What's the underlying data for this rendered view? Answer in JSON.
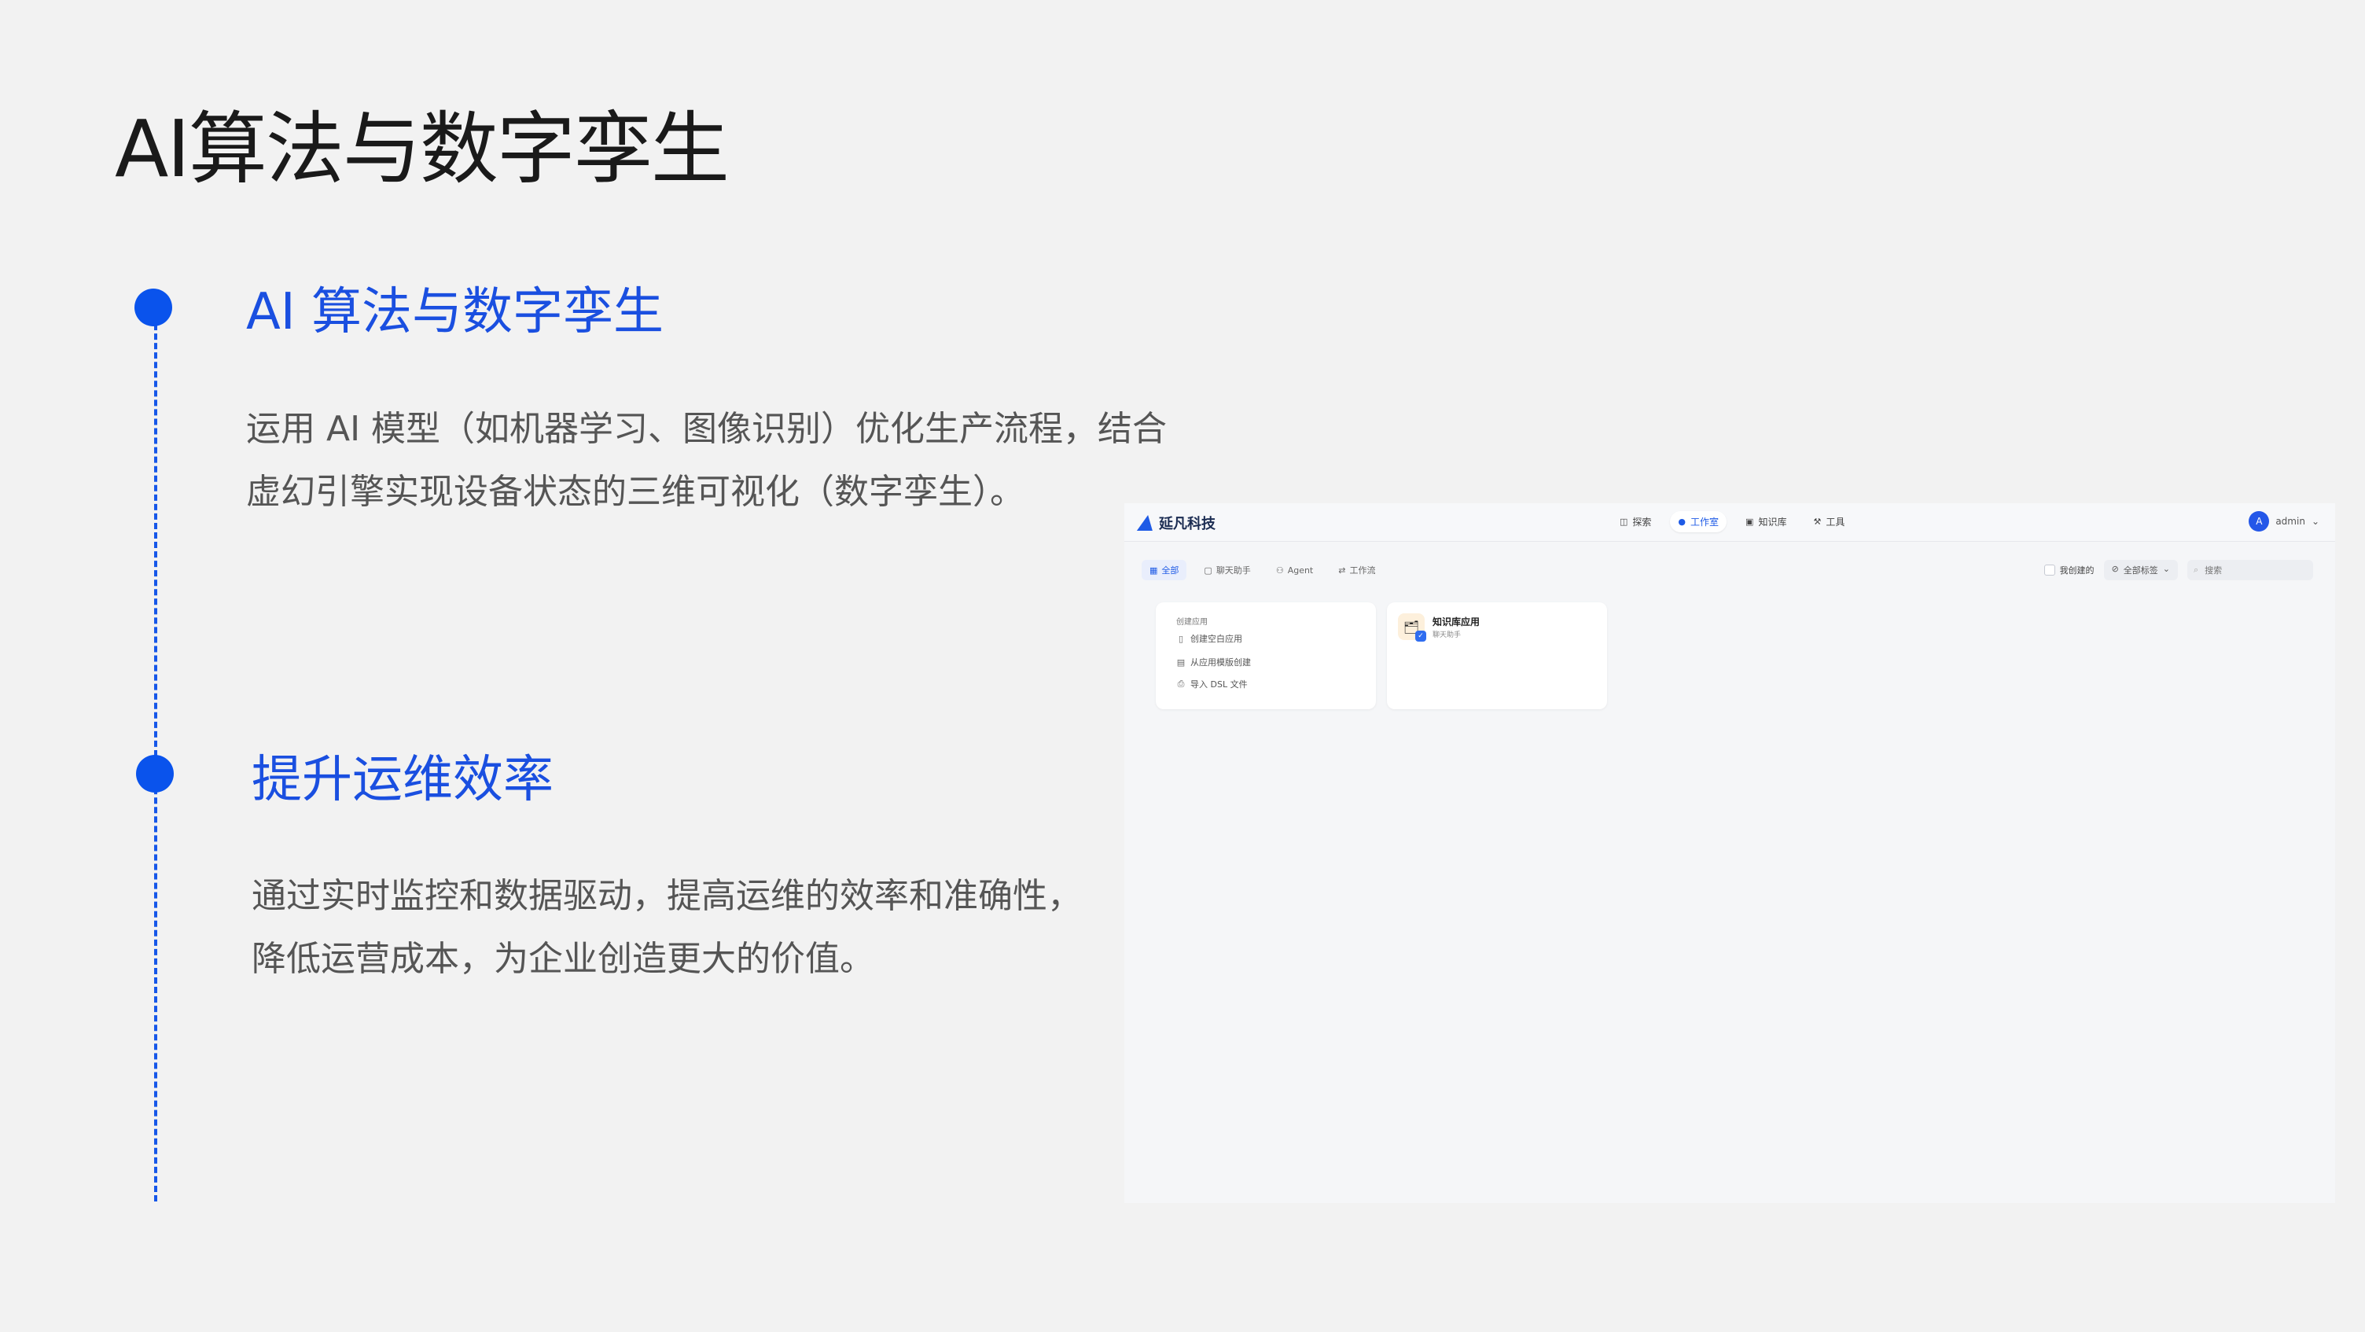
{
  "slide": {
    "title": "AI算法与数字孪生",
    "sections": [
      {
        "title": "AI 算法与数字孪生",
        "lines": [
          "运用 AI 模型（如机器学习、图像识别）优化生产流程，结合",
          "虚幻引擎实现设备状态的三维可视化（数字孪生）。"
        ]
      },
      {
        "title": "提升运维效率",
        "lines": [
          "通过实时监控和数据驱动，提高运维的效率和准确性，",
          "降低运营成本，为企业创造更大的价值。"
        ]
      }
    ]
  },
  "app": {
    "brand": "延凡科技",
    "nav": [
      {
        "label": "探索",
        "icon": "explore-icon"
      },
      {
        "label": "工作室",
        "icon": "studio-icon",
        "active": true
      },
      {
        "label": "知识库",
        "icon": "knowledge-icon"
      },
      {
        "label": "工具",
        "icon": "tool-icon"
      }
    ],
    "user": {
      "initial": "A",
      "name": "admin"
    },
    "tabs": [
      {
        "label": "全部",
        "active": true
      },
      {
        "label": "聊天助手"
      },
      {
        "label": "Agent"
      },
      {
        "label": "工作流"
      }
    ],
    "filters": {
      "mine_label": "我创建的",
      "tags_label": "全部标签",
      "search_placeholder": "搜索"
    },
    "create_card": {
      "heading": "创建应用",
      "items": [
        "创建空白应用",
        "从应用模版创建",
        "导入 DSL 文件"
      ]
    },
    "app_card": {
      "name": "知识库应用",
      "type": "聊天助手"
    }
  }
}
